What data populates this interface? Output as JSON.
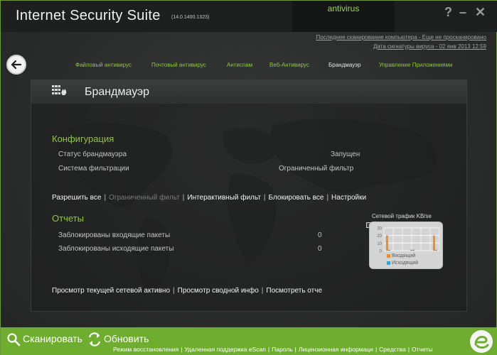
{
  "window": {
    "title": "Internet Security Suite",
    "version": "(14.0.1400.1323)",
    "product_tab": "antivirus",
    "help_label": "?",
    "minimize_label": "–",
    "close_label": "✕"
  },
  "status": {
    "last_scan": "Последнее сканирование компьютера - Еще не просканировано",
    "signature_date": "Дата сигнатуры вируса - 02 янв 2013 12:59"
  },
  "nav": {
    "back_icon": "arrow-left-icon",
    "tabs": [
      {
        "label": "Файловый антивирус"
      },
      {
        "label": "Почтовый антивирус"
      },
      {
        "label": "Антиспам"
      },
      {
        "label": "Веб-Антивирус"
      },
      {
        "label": "Брандмауэр"
      },
      {
        "label": "Управление Приложениями"
      }
    ],
    "active_index": 4
  },
  "panel": {
    "title": "Брандмауэр",
    "icon": "firewall-icon",
    "config": {
      "heading": "Конфигурация",
      "rows": [
        {
          "label": "Статус брандмауэра",
          "value": "Запущен"
        },
        {
          "label": "Система фильтрации",
          "value": "Ограниченный фильтр"
        }
      ]
    },
    "mode_links": [
      {
        "label": "Разрешить все",
        "enabled": true
      },
      {
        "label": "Ограниченный фильт",
        "enabled": false
      },
      {
        "label": "Интерактивный фильт",
        "enabled": true
      },
      {
        "label": "Блокировать все",
        "enabled": true
      },
      {
        "label": "Настройки",
        "enabled": true
      }
    ],
    "reports": {
      "heading": "Отчеты",
      "rows": [
        {
          "label": "Заблокированы входящие пакеты",
          "value": "0"
        },
        {
          "label": "Заблокированы исходящие пакеты",
          "value": "0"
        }
      ]
    },
    "bottom_links": [
      {
        "label": "Просмотр текущей сетевой активно"
      },
      {
        "label": "Просмотр сводной инфо"
      },
      {
        "label": "Посмотреть отче"
      }
    ]
  },
  "chart_data": {
    "type": "bar",
    "title": "Сетевой трафик KB/se",
    "ylim": [
      0,
      30
    ],
    "yticks": [
      "30",
      "20",
      "10",
      "0"
    ],
    "series": [
      {
        "name": "Входящий",
        "color": "#f28c28",
        "values": [
          20,
          0,
          20
        ]
      },
      {
        "name": "Исходящий",
        "color": "#3aa0c8",
        "values": [
          0,
          0,
          0
        ]
      }
    ],
    "grid": true,
    "legend": "bottom"
  },
  "bottom": {
    "scan_label": "Сканировать",
    "update_label": "Обновить",
    "links": [
      "Режим восстановления",
      "Удаленная поддержка eScan",
      "Пароль",
      "Лицензионная информаци",
      "Средства",
      "Отчеты"
    ]
  },
  "colors": {
    "accent_green": "#8fc83e",
    "bottom_bar": "#6fad2e",
    "background": "#2a2b2b"
  }
}
